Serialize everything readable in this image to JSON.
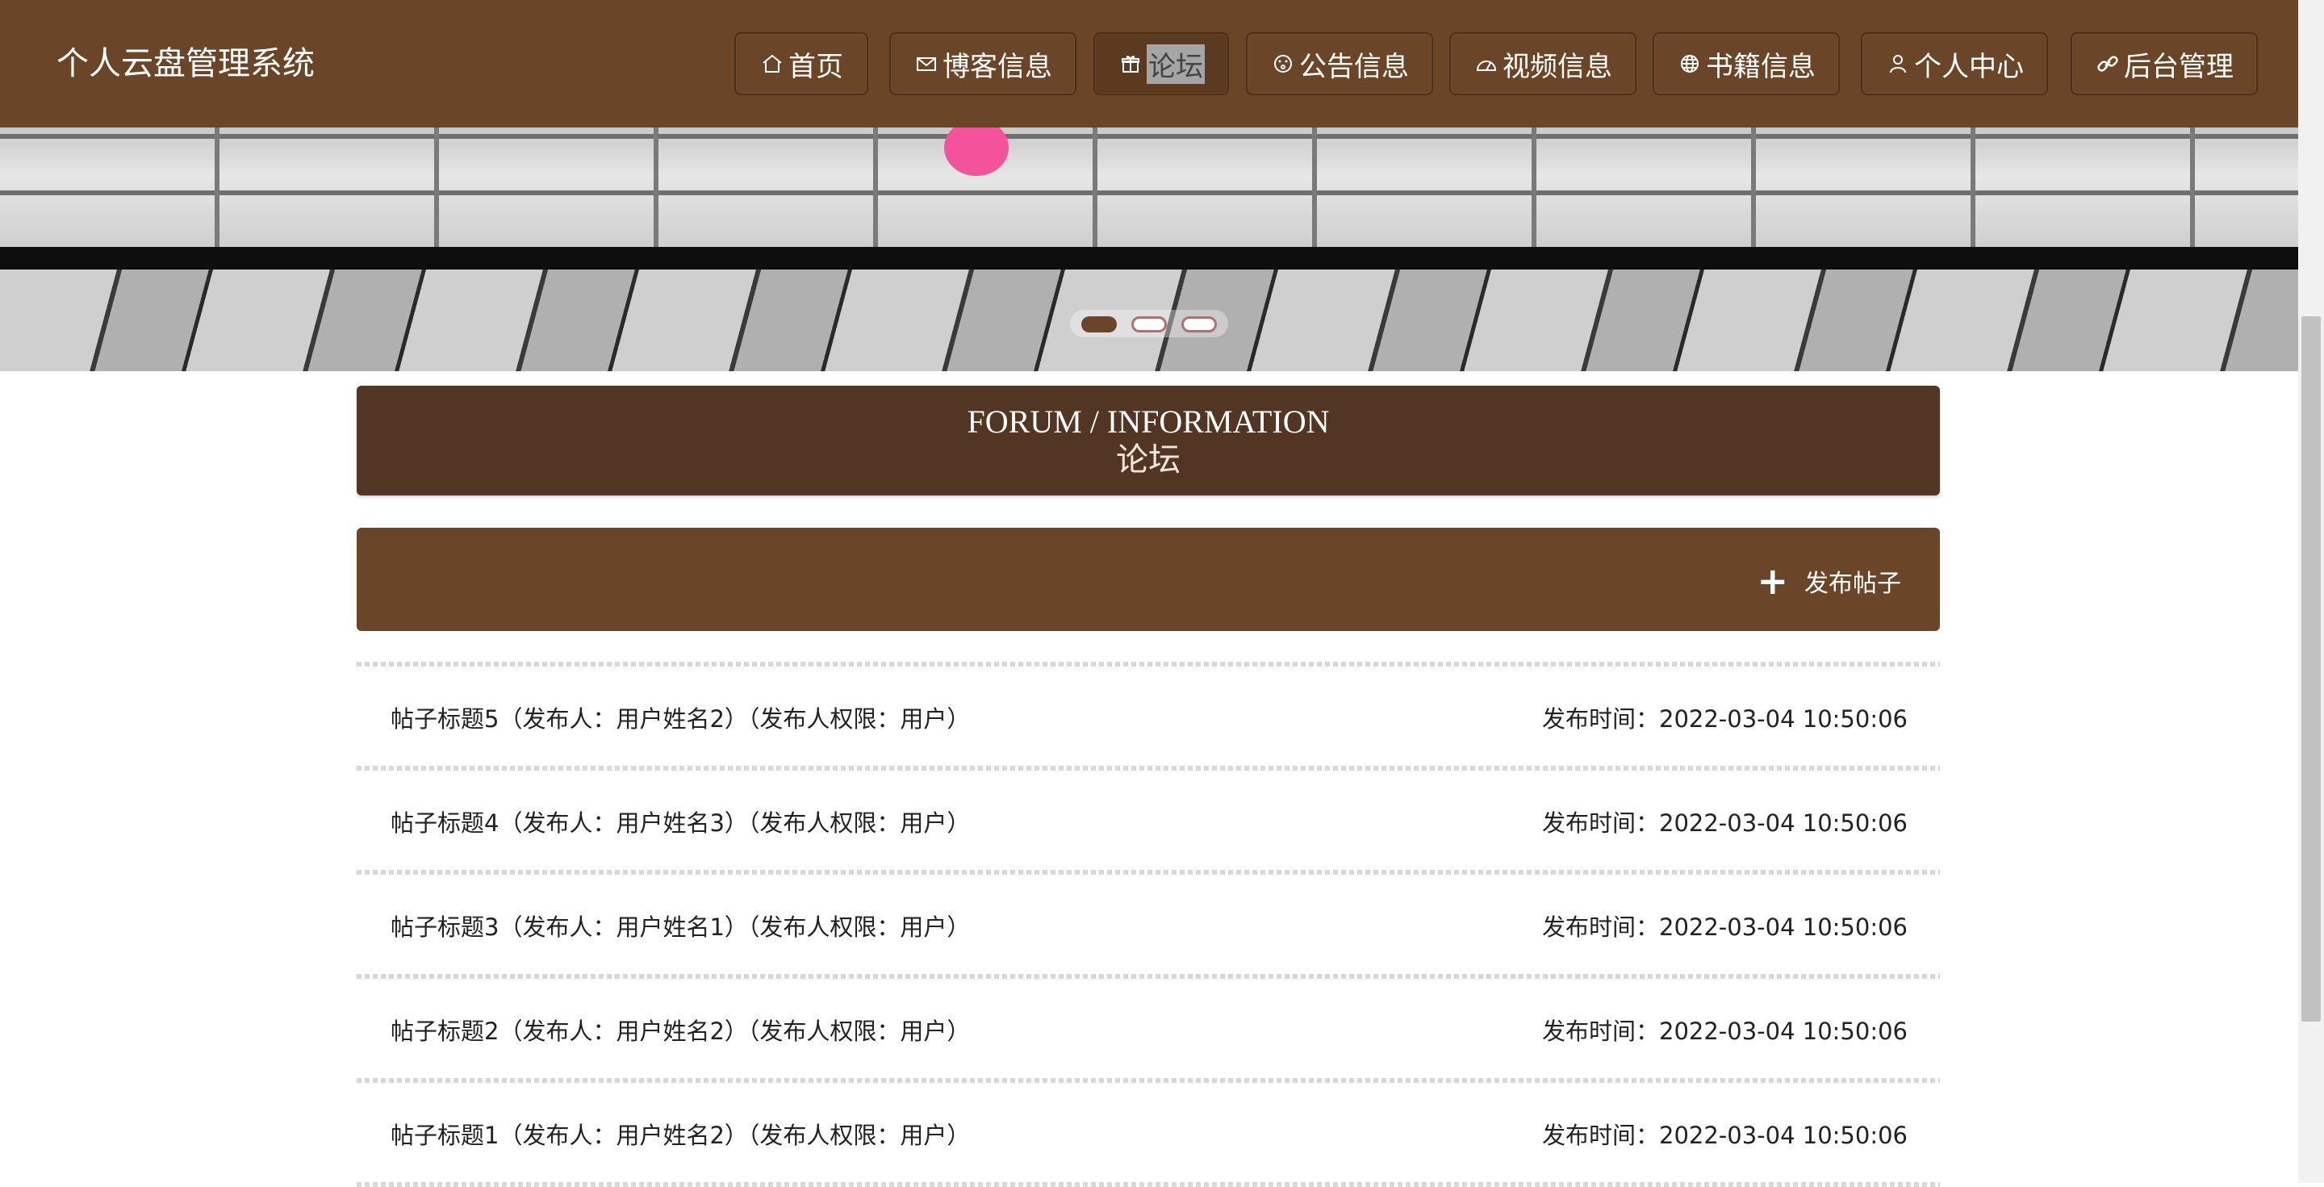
{
  "header": {
    "brand": "个人云盘管理系统",
    "nav": [
      {
        "label": "首页",
        "icon": "home-icon"
      },
      {
        "label": "博客信息",
        "icon": "mail-icon"
      },
      {
        "label": "论坛",
        "icon": "gift-icon",
        "active": true
      },
      {
        "label": "公告信息",
        "icon": "smile-icon"
      },
      {
        "label": "视频信息",
        "icon": "gauge-icon"
      },
      {
        "label": "书籍信息",
        "icon": "globe-icon"
      },
      {
        "label": "个人中心",
        "icon": "user-icon"
      },
      {
        "label": "后台管理",
        "icon": "link-icon"
      }
    ]
  },
  "banner": {
    "carousel_slide_count": 3,
    "active_slide": 1
  },
  "section": {
    "title_en": "FORUM / INFORMATION",
    "title_cn": "论坛"
  },
  "actions": {
    "post_label": "发布帖子"
  },
  "posts": [
    {
      "title": "帖子标题5（发布人：用户姓名2）（发布人权限：用户）",
      "time": "发布时间：2022-03-04 10:50:06"
    },
    {
      "title": "帖子标题4（发布人：用户姓名3）（发布人权限：用户）",
      "time": "发布时间：2022-03-04 10:50:06"
    },
    {
      "title": "帖子标题3（发布人：用户姓名1）（发布人权限：用户）",
      "time": "发布时间：2022-03-04 10:50:06"
    },
    {
      "title": "帖子标题2（发布人：用户姓名2）（发布人权限：用户）",
      "time": "发布时间：2022-03-04 10:50:06"
    },
    {
      "title": "帖子标题1（发布人：用户姓名2）（发布人权限：用户）",
      "time": "发布时间：2022-03-04 10:50:06"
    }
  ],
  "colors": {
    "header_bg": "#6b4527",
    "title_bg": "#523522",
    "accent_pink": "#f4529b"
  }
}
